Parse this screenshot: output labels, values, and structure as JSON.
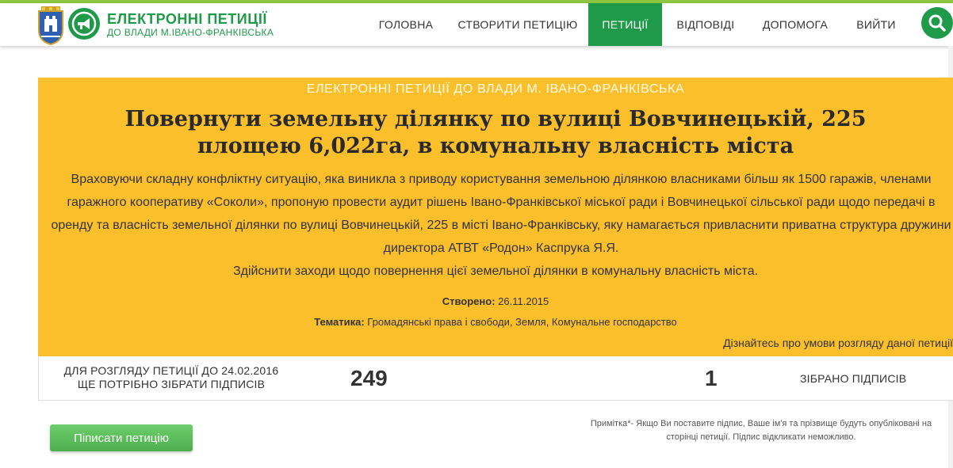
{
  "header": {
    "brand_title": "ЕЛЕКТРОННІ ПЕТИЦІЇ",
    "brand_subtitle": "ДО ВЛАДИ М.ІВАНО-ФРАНКІВСЬКА",
    "nav": [
      {
        "label": "ГОЛОВНА"
      },
      {
        "label": "СТВОРИТИ ПЕТИЦІЮ"
      },
      {
        "label": "ПЕТИЦІЇ",
        "active": true
      },
      {
        "label": "ВІДПОВІДІ"
      },
      {
        "label": "ДОПОМОГА"
      },
      {
        "label": "ВИЙТИ"
      }
    ],
    "accent_color": "#1f9a49",
    "top_line_color": "#8ec641"
  },
  "petition": {
    "kicker": "ЕЛЕКТРОННІ ПЕТИЦІЇ ДО ВЛАДИ М. ІВАНО-ФРАНКІВСЬКА",
    "title": "Повернути земельну ділянку по вулиці Вовчинецькій, 225 площею 6,022га, в комунальну власність міста",
    "description": "Враховуючи складну конфліктну ситуацію, яка виникла з приводу користування земельною ділянкою власниками більш як 1500 гаражів, членами гаражного кооперативу «Соколи», пропоную провести аудит рішень Івано-Франківської міської ради і Вовчинецької сільської ради щодо передачі в оренду та власність земельної ділянки по вулиці Вовчинецькій, 225 в місті Івано-Франківську, яку намагається привласнити приватна структура дружини директора АТВТ «Родон» Каспрука Я.Я.",
    "action": "Здійснити заходи щодо повернення цієї земельної ділянки в комунальну власність міста.",
    "created_label": "Створено:",
    "created_value": "26.11.2015",
    "topics_label": "Тематика:",
    "topics_value": "Громадянські права і свободи, Земля, Комунальне господарство",
    "conditions_link": "Дізнайтесь про умови розгляду даної петиції",
    "card_color": "#fbbf2b"
  },
  "stats": {
    "note_line1": "ДЛЯ РОЗГЛЯДУ ПЕТИЦІЇ ДО 24.02.2016",
    "note_line2": "ЩЕ ПОТРІБНО ЗІБРАТИ ПІДПИСІВ",
    "remaining": "249",
    "collected": "1",
    "collected_label": "ЗІБРАНО ПІДПИСІВ"
  },
  "actions": {
    "sign_button": "Пiписати петицію",
    "footnote_line1": "Примітка*- Якщо Ви поставите підпис, Ваше ім'я та прізвище будуть опубліковані на",
    "footnote_line2": "сторінці петиції. Підпис відкликати неможливо."
  },
  "icons": {
    "coat_of_arms": "city-coat-of-arms-icon",
    "logo": "megaphone-icon",
    "search": "search-icon"
  }
}
